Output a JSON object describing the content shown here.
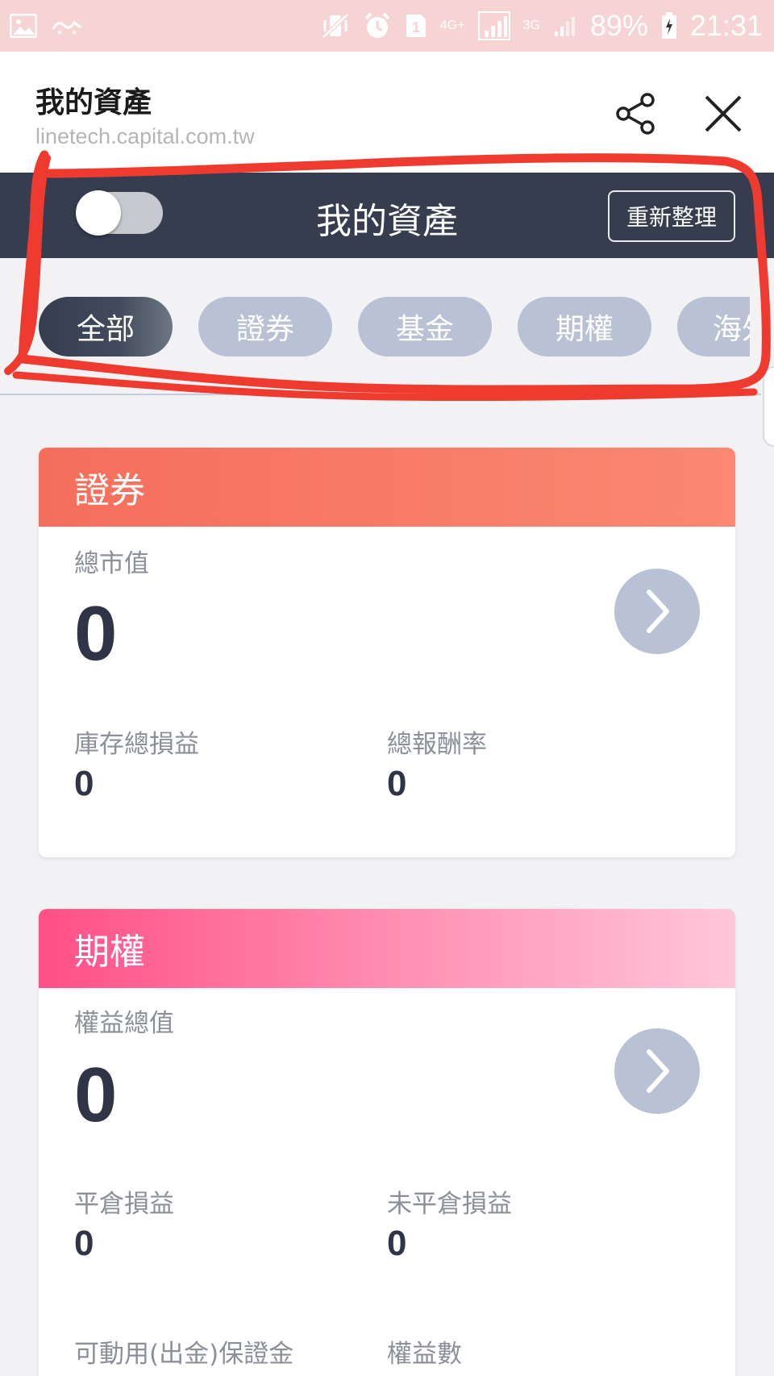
{
  "status_bar": {
    "battery": "89%",
    "time": "21:31",
    "sim_slot": "1",
    "network_1": "4G+",
    "network_2": "3G",
    "icons": [
      "gallery-icon",
      "app-icon",
      "vibrate-mute-icon",
      "alarm-icon",
      "sim-icon",
      "signal-icon",
      "battery-charging-icon"
    ]
  },
  "browser_header": {
    "title": "我的資產",
    "url": "linetech.capital.com.tw",
    "share_icon": "share-icon",
    "close_icon": "close-icon"
  },
  "app_header": {
    "title": "我的資產",
    "refresh_label": "重新整理",
    "toggle_on": false
  },
  "tabs": [
    {
      "label": "全部",
      "active": true
    },
    {
      "label": "證券",
      "active": false
    },
    {
      "label": "基金",
      "active": false
    },
    {
      "label": "期權",
      "active": false
    },
    {
      "label": "海外",
      "active": false
    }
  ],
  "cards": {
    "securities": {
      "title": "證券",
      "main_label": "總市值",
      "main_value": "0",
      "metric1_label": "庫存總損益",
      "metric1_value": "0",
      "metric2_label": "總報酬率",
      "metric2_value": "0"
    },
    "options": {
      "title": "期權",
      "main_label": "權益總值",
      "main_value": "0",
      "metric1_label": "平倉損益",
      "metric1_value": "0",
      "metric2_label": "未平倉損益",
      "metric2_value": "0",
      "metric3_label": "可動用(出金)保證金",
      "metric4_label": "權益數"
    }
  },
  "colors": {
    "status_bar": "#f6d4d3",
    "app_header": "#353d4f",
    "tab_inactive": "#b9c2d4",
    "securities_header": "#f56e5b",
    "options_header": "#ff4f88",
    "annotation": "#ef3b2f"
  }
}
